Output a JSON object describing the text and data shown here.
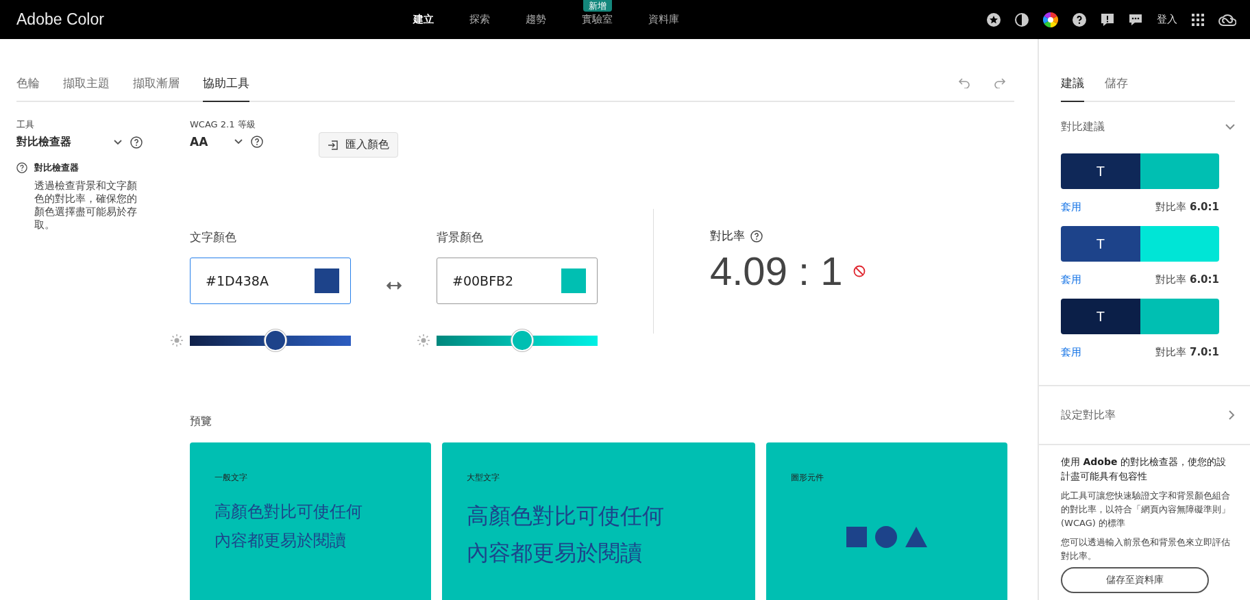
{
  "header": {
    "logo": "Adobe Color",
    "nav": [
      {
        "label": "建立",
        "selected": true
      },
      {
        "label": "探索",
        "selected": false
      },
      {
        "label": "趨勢",
        "selected": false
      },
      {
        "label": "實驗室",
        "selected": false,
        "badge": "新增"
      },
      {
        "label": "資料庫",
        "selected": false
      }
    ],
    "sign_in": "登入"
  },
  "tabs": [
    {
      "label": "色輪",
      "selected": false
    },
    {
      "label": "擷取主題",
      "selected": false
    },
    {
      "label": "擷取漸層",
      "selected": false
    },
    {
      "label": "協助工具",
      "selected": true
    }
  ],
  "tool": {
    "label": "工具",
    "value": "對比檢查器",
    "help_title": "對比檢查器",
    "help_text": "透過檢查背景和文字顏色的對比率，確保您的顏色選擇盡可能易於存取。"
  },
  "wcag": {
    "label": "WCAG 2.1 等級",
    "value": "AA"
  },
  "import_button": "匯入顏色",
  "colors": [
    {
      "label": "文字顏色",
      "value": "#1D438A",
      "color": "#1d438a",
      "focused": true,
      "level": 0.53
    },
    {
      "label": "背景顏色",
      "value": "#00BFB2",
      "color": "#00bfb2",
      "focused": false,
      "level": 0.53
    }
  ],
  "contrast": {
    "label": "對比率",
    "value": "4.09 : 1",
    "passes": false
  },
  "preview": {
    "label": "預覽",
    "cards": [
      {
        "kind": "text",
        "label": "一般文字",
        "text": "高顏色對比可使任何內容都更易於閱讀"
      },
      {
        "kind": "large",
        "label": "大型文字",
        "text": "高顏色對比可使任何內容都更易於閱讀"
      },
      {
        "kind": "shapes",
        "label": "圖形元件"
      }
    ]
  },
  "side_tabs": [
    {
      "label": "建議",
      "selected": true
    },
    {
      "label": "儲存",
      "selected": false
    }
  ],
  "suggestions": {
    "title": "對比建議",
    "expanded": true,
    "items": [
      {
        "swatches": [
          {
            "color": "#0f2858",
            "letter": "T"
          },
          {
            "color": "#00bfb2"
          }
        ],
        "apply": "套用",
        "ratio_label": "對比率",
        "ratio": "6.0:1"
      },
      {
        "swatches": [
          {
            "color": "#1d438a",
            "letter": "T"
          },
          {
            "color": "#00e5d6"
          }
        ],
        "apply": "套用",
        "ratio_label": "對比率",
        "ratio": "6.0:1"
      },
      {
        "swatches": [
          {
            "color": "#0b1f48",
            "letter": "T"
          },
          {
            "color": "#00bfb2"
          }
        ],
        "apply": "套用",
        "ratio_label": "對比率",
        "ratio": "7.0:1"
      }
    ]
  },
  "set_ratio": "設定對比率",
  "info": {
    "heading": "使用 **Adobe** 的對比檢查器，使您的設計盡可能具有包容性",
    "paragraphs": [
      "此工具可讓您快速驗證文字和背景顏色組合的對比率，以符合「網頁內容無障礙準則」(WCAG) 的標準",
      "您可以透過輸入前景色和背景色來立即評估對比率。"
    ]
  },
  "save_button": "儲存至資料庫"
}
